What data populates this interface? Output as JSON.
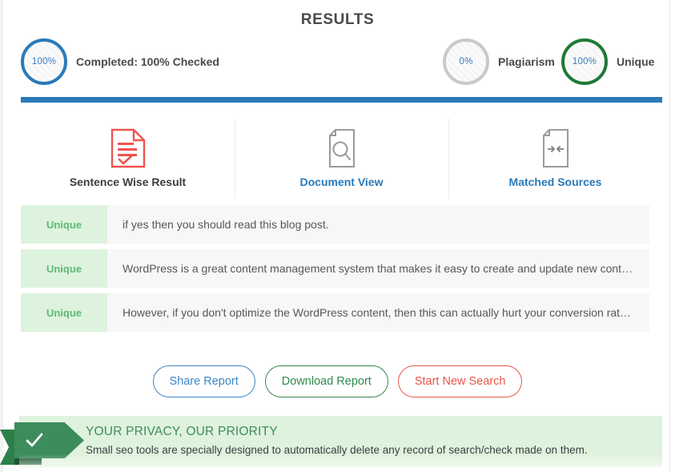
{
  "page": {
    "title": "RESULTS"
  },
  "stats": [
    {
      "name": "completed",
      "percent": "100%",
      "label": "Completed: 100% Checked",
      "ring_color": "#2a7ab9"
    },
    {
      "name": "plagiarism",
      "percent": "0%",
      "label": "Plagiarism",
      "ring_color": "#c9c9c9"
    },
    {
      "name": "unique",
      "percent": "100%",
      "label": "Unique",
      "ring_color": "#1e7a36"
    }
  ],
  "progress": {
    "value": "100%",
    "color": "#2a7ab9"
  },
  "tabs": [
    {
      "label": "Sentence Wise Result",
      "icon": "document-checklist-icon",
      "active": true,
      "color": "#3d3d3d"
    },
    {
      "label": "Document View",
      "icon": "document-search-icon",
      "active": false,
      "color": "#2a7ab9"
    },
    {
      "label": "Matched Sources",
      "icon": "document-compare-icon",
      "active": false,
      "color": "#2a7ab9"
    }
  ],
  "results": [
    {
      "status": "Unique",
      "text": "if yes then you should read this blog post."
    },
    {
      "status": "Unique",
      "text": "WordPress is a great content management system that makes it easy to create and update new cont…"
    },
    {
      "status": "Unique",
      "text": "However, if you don't optimize the WordPress content, then this can actually hurt your conversion rat…"
    }
  ],
  "actions": [
    {
      "label": "Share Report",
      "style": "blue",
      "color": "#3d86c6"
    },
    {
      "label": "Download Report",
      "style": "green",
      "color": "#2f8a4c"
    },
    {
      "label": "Start New Search",
      "style": "red",
      "color": "#e8564a"
    }
  ],
  "privacy": {
    "title": "YOUR PRIVACY, OUR PRIORITY",
    "subtitle": "Small seo tools are specially designed to automatically delete any record of search/check made on them.",
    "icon": "check-ribbon-icon",
    "background": "#dff2dd"
  }
}
